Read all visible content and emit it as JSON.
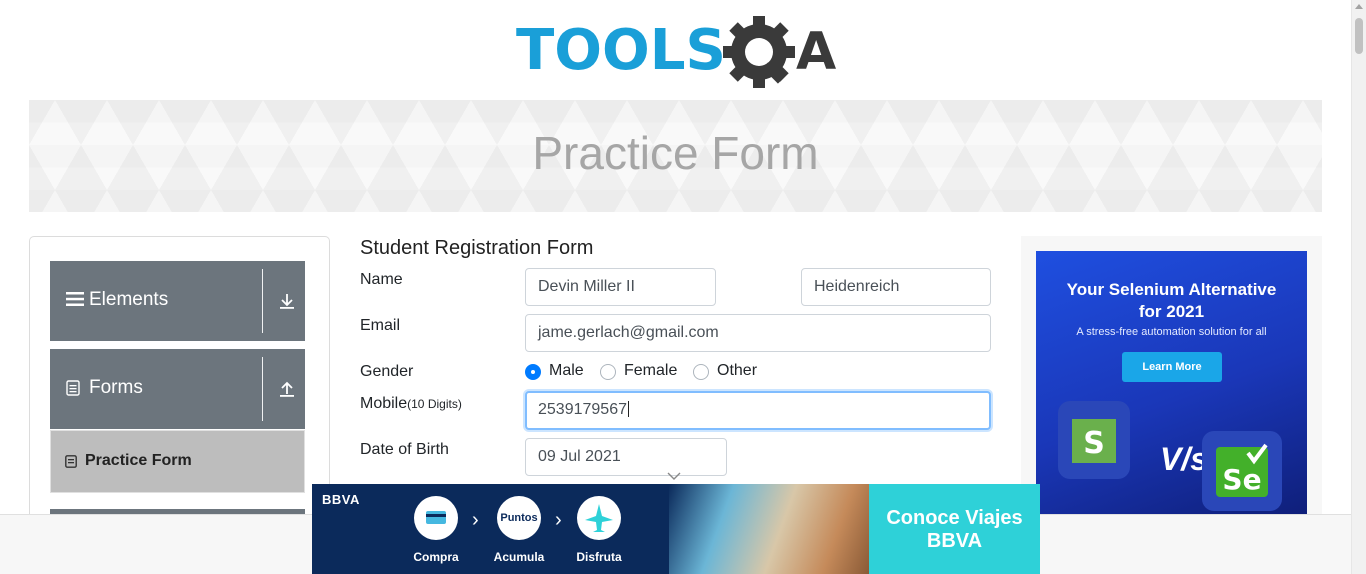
{
  "header": {
    "logo_text_left": "TOOLS",
    "logo_text_right": "A"
  },
  "banner": {
    "title": "Practice Form"
  },
  "sidebar": {
    "groups": [
      {
        "label": "Elements",
        "icon": "menu-icon",
        "toggle_icon": "download-icon"
      },
      {
        "label": "Forms",
        "icon": "document-icon",
        "toggle_icon": "upload-icon"
      }
    ],
    "active_item": {
      "label": "Practice Form",
      "icon": "form-icon"
    }
  },
  "form": {
    "title": "Student Registration Form",
    "name_label": "Name",
    "first_name": "Devin Miller II",
    "last_name": "Heidenreich",
    "email_label": "Email",
    "email": "jame.gerlach@gmail.com",
    "gender_label": "Gender",
    "genders": [
      "Male",
      "Female",
      "Other"
    ],
    "gender_selected": "Male",
    "mobile_label": "Mobile",
    "mobile_hint": "(10 Digits)",
    "mobile": "2539179567",
    "dob_label": "Date of Birth",
    "dob": "09 Jul 2021"
  },
  "ad_right": {
    "headline": "Your Selenium Alternative for 2021",
    "subline": "A stress-free automation solution for all",
    "button": "Learn More",
    "vs_text": "V/s"
  },
  "ad_bottom": {
    "brand": "BBVA",
    "steps": [
      "Compra",
      "Acumula",
      "Disfruta"
    ],
    "badge": "Puntos",
    "cta": "Conoce Viajes BBVA"
  }
}
